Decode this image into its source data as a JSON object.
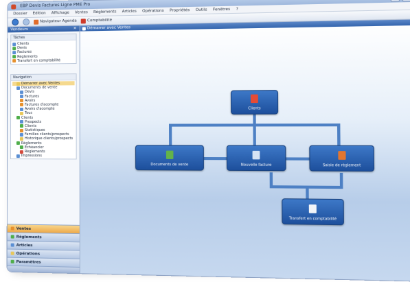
{
  "window": {
    "title": "EBP Devis Factures Ligne PME Pro"
  },
  "menu": [
    "Dossier",
    "Edition",
    "Affichage",
    "Ventes",
    "Règlements",
    "Articles",
    "Opérations",
    "Propriétés",
    "Outils",
    "Fenêtres",
    "?"
  ],
  "toolbar": {
    "btn1": "Navigateur Agenda",
    "btn2": "Comptabilité"
  },
  "sidebar": {
    "header": "Vendeurs",
    "group1_title": "Tâches",
    "group1_items": [
      "Clients",
      "Devis",
      "Factures",
      "Règlements",
      "Transfert en comptabilité"
    ],
    "group2_title": "Navigation",
    "group2_items": [
      {
        "label": "Démarrer avec Ventes",
        "indent": 1,
        "selected": true
      },
      {
        "label": "Documents de vente",
        "indent": 1
      },
      {
        "label": "Devis",
        "indent": 2
      },
      {
        "label": "Factures",
        "indent": 2
      },
      {
        "label": "Avoirs",
        "indent": 2
      },
      {
        "label": "Factures d'acompte",
        "indent": 2
      },
      {
        "label": "Avoirs d'acompte",
        "indent": 2
      },
      {
        "label": "Tous",
        "indent": 2
      },
      {
        "label": "Clients",
        "indent": 1
      },
      {
        "label": "Prospects",
        "indent": 2
      },
      {
        "label": "Clients",
        "indent": 2
      },
      {
        "label": "Statistiques",
        "indent": 2
      },
      {
        "label": "Familles clients/prospects",
        "indent": 2
      },
      {
        "label": "Historique clients/prospects",
        "indent": 2
      },
      {
        "label": "Règlements",
        "indent": 1
      },
      {
        "label": "Echéancier",
        "indent": 2
      },
      {
        "label": "Règlements",
        "indent": 2
      },
      {
        "label": "Impressions",
        "indent": 1
      }
    ],
    "nav_buttons": [
      "Ventes",
      "Règlements",
      "Articles",
      "Opérations",
      "Paramètres"
    ]
  },
  "main": {
    "header": "Démarrer avec Ventes",
    "nodes": {
      "clients": "Clients",
      "documents": "Documents de vente",
      "factures": "Nouvelle facture",
      "saisie": "Saisie de règlement",
      "transfert": "Transfert en comptabilité"
    }
  }
}
